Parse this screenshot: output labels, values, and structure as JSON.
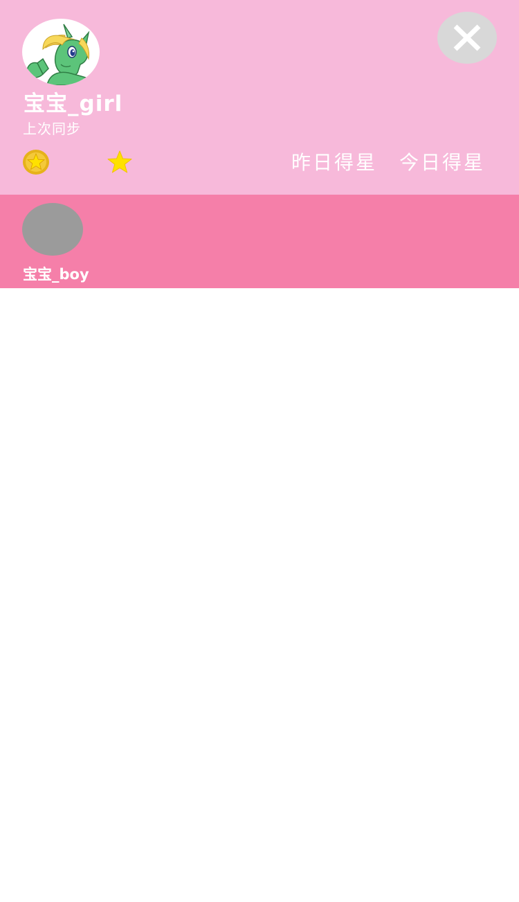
{
  "current_baby": {
    "name": "宝宝_girl",
    "sync_label": "上次同步",
    "avatar_icon": "unicorn-pony-avatar",
    "coin_icon": "gold-star-coin-icon",
    "star_icon": "yellow-star-icon",
    "yesterday_label": "昨日得星",
    "today_label": "今日得星"
  },
  "close": {
    "icon": "close-icon"
  },
  "baby_list": [
    {
      "name": "宝宝_boy",
      "avatar": "gray-placeholder"
    }
  ],
  "colors": {
    "header_background": "#f7b9da",
    "list_background": "#f57fa9",
    "close_button": "#d8d8d8",
    "placeholder_avatar": "#9b9b9b",
    "star": "#ffe100",
    "coin": "#e6b21a",
    "text": "#ffffff"
  }
}
